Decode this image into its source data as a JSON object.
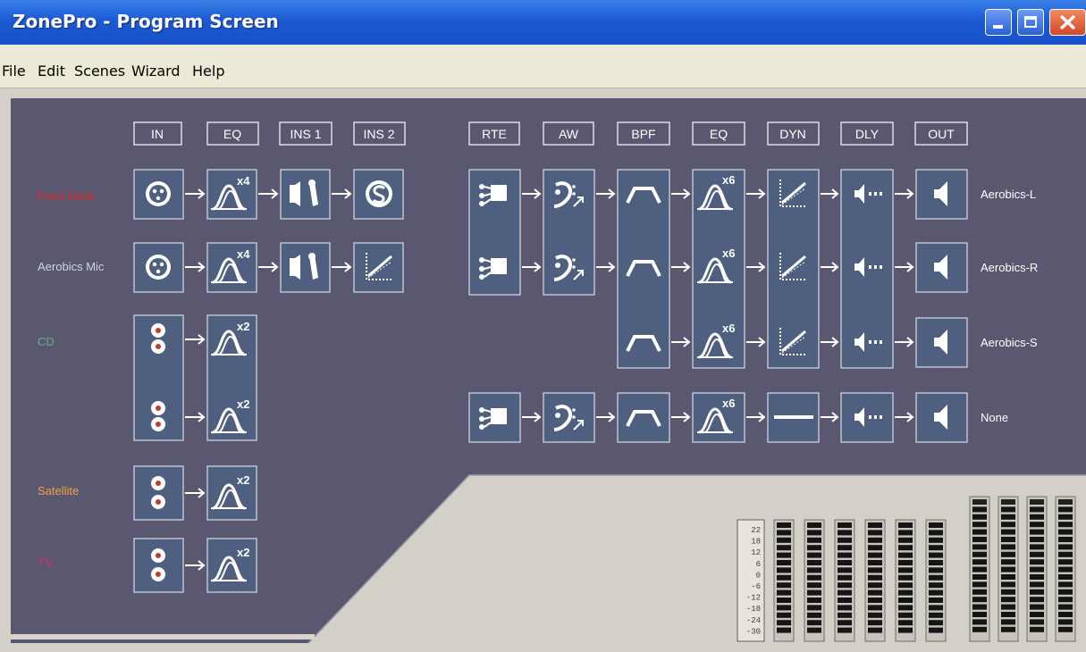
{
  "window": {
    "title": "ZonePro - Program Screen"
  },
  "menu": [
    "File",
    "Edit",
    "Scenes",
    "Wizard",
    "Help"
  ],
  "input_headers": [
    "IN",
    "EQ",
    "INS 1",
    "INS 2"
  ],
  "output_headers": [
    "RTE",
    "AW",
    "BPF",
    "EQ",
    "DYN",
    "DLY",
    "OUT"
  ],
  "inputs": [
    {
      "name": "Front Desk",
      "color": "#e02828",
      "eq_badge": "x4"
    },
    {
      "name": "Aerobics Mic",
      "color": "#d0d4e0",
      "eq_badge": "x4"
    },
    {
      "name": "CD",
      "color": "#60b080",
      "eq_badge": "x2"
    },
    {
      "name": "Satellite",
      "color": "#f0a040",
      "eq_badge": "x2"
    },
    {
      "name": "TV",
      "color": "#d03070",
      "eq_badge": "x2"
    }
  ],
  "outputs": [
    {
      "name": "Aerobics-L",
      "eq_badge": "x6"
    },
    {
      "name": "Aerobics-R",
      "eq_badge": "x6"
    },
    {
      "name": "Aerobics-S",
      "eq_badge": "x6"
    },
    {
      "name": "None",
      "eq_badge": "x6"
    }
  ],
  "meter_scale": [
    "22",
    "18",
    "12",
    "6",
    "0",
    "-6",
    "-12",
    "-18",
    "-24",
    "-30"
  ],
  "colors": {
    "panel": "#5a5870",
    "block": "#4f5f80",
    "titlebar": "#1c5ad2",
    "chrome": "#d4d0c8"
  }
}
